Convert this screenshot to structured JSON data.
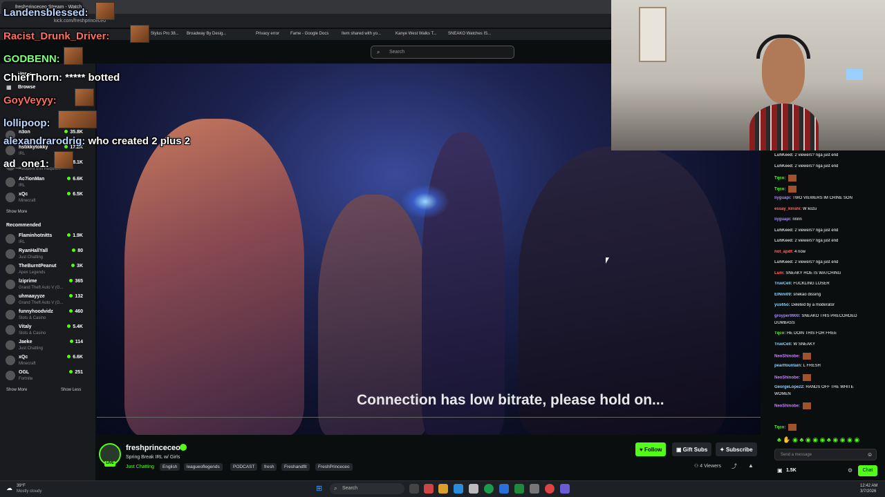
{
  "browser": {
    "tab_title": "freshprinceceo Stream - Watch",
    "url": "kick.com/freshprinceceo",
    "bookmarks": [
      "Stylus Pro 38...",
      "Broadway By Desig...",
      "Privacy error",
      "Fame - Google Docs",
      "Item shared with yo...",
      "Kanye West Walks T...",
      "SNEAKO Watches IS..."
    ]
  },
  "kick": {
    "search_placeholder": "Search"
  },
  "sidebar": {
    "nav": [
      "Home",
      "Browse"
    ],
    "following": [
      {
        "name": "n3on",
        "category": "",
        "viewers": "35.8K"
      },
      {
        "name": "hstikkytokky",
        "category": "IRL",
        "viewers": "17.2K"
      },
      {
        "name": "",
        "category": "Resident Evil Requiem",
        "viewers": "8.1K"
      },
      {
        "name": "Ac7ionMan",
        "category": "IRL",
        "viewers": "6.6K"
      },
      {
        "name": "xQc",
        "category": "Minecraft",
        "viewers": "6.5K"
      }
    ],
    "show_more": "Show More",
    "recommended_label": "Recommended",
    "recommended": [
      {
        "name": "Flaminhotnitts",
        "category": "IRL",
        "viewers": "1.9K"
      },
      {
        "name": "RyanHallYall",
        "category": "Just Chatting",
        "viewers": "80"
      },
      {
        "name": "TheBurntPeanut",
        "category": "Apex Legends",
        "viewers": "3K"
      },
      {
        "name": "lziprime",
        "category": "Grand Theft Auto V (G...",
        "viewers": "365"
      },
      {
        "name": "uhmaayyze",
        "category": "Grand Theft Auto V (G...",
        "viewers": "132"
      },
      {
        "name": "funnyhoodvidz",
        "category": "Slots & Casino",
        "viewers": "460"
      },
      {
        "name": "Vitaly",
        "category": "Slots & Casino",
        "viewers": "5.4K"
      },
      {
        "name": "Jaeke",
        "category": "Just Chatting",
        "viewers": "114"
      },
      {
        "name": "xQc",
        "category": "Minecraft",
        "viewers": "6.6K"
      },
      {
        "name": "OGL",
        "category": "Fortnite",
        "viewers": "251"
      }
    ],
    "show_more_2": "Show More",
    "show_less": "Show Less"
  },
  "overlay_chat": [
    {
      "user": "Landensblessed:",
      "text": "",
      "color": "#b9d7ff"
    },
    {
      "user": "Racist_Drunk_Driver:",
      "text": "",
      "color": "#ff6f61"
    },
    {
      "user": "GODBENN:",
      "text": "",
      "color": "#7dff7d"
    },
    {
      "user": "ChiefThorn:",
      "text": "***** botted",
      "color": "#ffffff"
    },
    {
      "user": "GoyVeyyy:",
      "text": "",
      "color": "#ff6f61"
    },
    {
      "user": "lollipoop:",
      "text": "",
      "color": "#b9d7ff"
    },
    {
      "user": "alexandrarodrig:",
      "text": "who created 2 plus 2",
      "color": "#b9d7ff"
    },
    {
      "user": "ad_one1:",
      "text": "",
      "color": "#ffffff"
    }
  ],
  "video": {
    "status_message": "Connection has low bitrate, please hold on..."
  },
  "stream": {
    "streamer": "freshprinceceo",
    "title": "Spring Break IRL w/ Girls",
    "category": "Just Chatting",
    "tags": [
      "English",
      "leagueoflegends",
      "PODCAST",
      "fresh",
      "Freshandfit",
      "FreshPrinceceo"
    ],
    "follow_label": "Follow",
    "gift_label": "Gift Subs",
    "subscribe_label": "Subscribe",
    "viewers": "4 Viewers",
    "live_label": "LIVE"
  },
  "chat": {
    "messages": [
      {
        "user": "LuhKeed:",
        "text": "2 viewers? nga just end",
        "color": "#cfcfcf"
      },
      {
        "user": "LuhKeed:",
        "text": "2 viewers? nga just end",
        "color": "#cfcfcf"
      },
      {
        "user": "Tqco:",
        "text": "",
        "color": "#53fc18"
      },
      {
        "user": "Tqco:",
        "text": "",
        "color": "#53fc18"
      },
      {
        "user": "liyguapi:",
        "text": "TWO VIEWERS IM CRINE SON",
        "color": "#a78bfa"
      },
      {
        "user": "essay_kinshi:",
        "text": "W kozu",
        "color": "#ff6b6b"
      },
      {
        "user": "liyguapi:",
        "text": "nnnn",
        "color": "#a78bfa"
      },
      {
        "user": "LuhKeed:",
        "text": "2 viewers? nga just end",
        "color": "#cfcfcf"
      },
      {
        "user": "LuhKeed:",
        "text": "2 viewers? nga just end",
        "color": "#cfcfcf"
      },
      {
        "user": "not_apdf:",
        "text": "4 now",
        "color": "#ff6b6b"
      },
      {
        "user": "LuhKeed:",
        "text": "2 viewers? nga just end",
        "color": "#cfcfcf"
      },
      {
        "user": "Lum:",
        "text": "SNEAKY HOE IS WATCHING",
        "color": "#ff6b6b"
      },
      {
        "user": "TrueCell:",
        "text": "FUCKLING LOSER",
        "color": "#8fd3ff"
      },
      {
        "user": "ElNini09:",
        "text": "snekao dissing",
        "color": "#8fd3ff"
      },
      {
        "user": "yus65o:",
        "text": "Deleted by a moderator",
        "color": "#8fd3ff"
      },
      {
        "user": "groyper9900:",
        "text": "SNEAKO THIS PRECORDED",
        "color": "#a78bfa"
      },
      {
        "user": "",
        "text": "DUMBASS",
        "color": "#ffffff"
      },
      {
        "user": "Tqco:",
        "text": "HE DOIN THIS FOR FREE",
        "color": "#53fc18"
      },
      {
        "user": "TrueCell:",
        "text": "W SNEAKY",
        "color": "#8fd3ff"
      },
      {
        "user": "NeoShinobe:",
        "text": "",
        "color": "#c084fc"
      },
      {
        "user": "pearlfountain:",
        "text": "L FRESH",
        "color": "#8fd3ff"
      },
      {
        "user": "NeoShinobe:",
        "text": "",
        "color": "#c084fc"
      },
      {
        "user": "GeorgeLopez2:",
        "text": "HANDS OFF THE WHITE",
        "color": "#8fd3ff"
      },
      {
        "user": "",
        "text": "WOMEN",
        "color": "#ffffff"
      },
      {
        "user": "NeoShinobe:",
        "text": "",
        "color": "#c084fc"
      },
      {
        "user": "",
        "text": "",
        "color": "#ff6b6b"
      },
      {
        "user": "Tqco:",
        "text": "",
        "color": "#53fc18"
      }
    ],
    "input_placeholder": "Send a message",
    "count": "1.5K",
    "chat_button": "Chat"
  },
  "taskbar": {
    "weather_temp": "39°F",
    "weather_desc": "Mostly cloudy",
    "search_placeholder": "Search",
    "time": "12:42 AM",
    "date": "3/7/2026"
  }
}
